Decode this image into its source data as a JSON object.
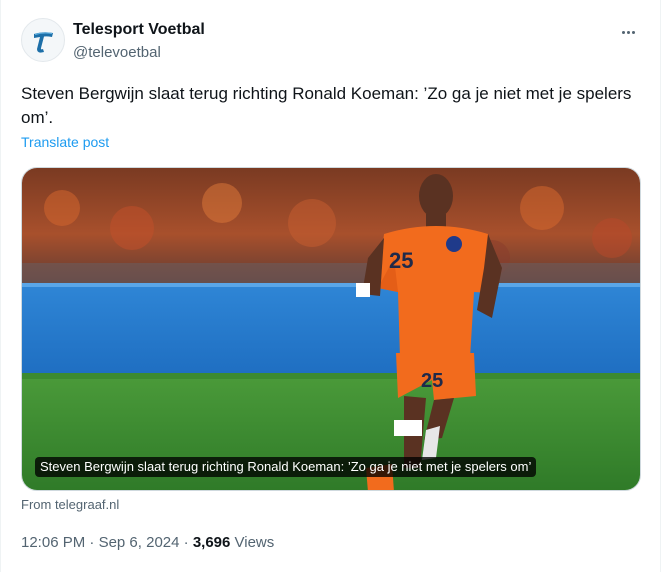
{
  "account": {
    "display_name": "Telesport Voetbal",
    "handle": "@televoetbal",
    "avatar_icon": "telesport-t-logo"
  },
  "post": {
    "text": "Steven Bergwijn slaat terug richting Ronald Koeman: ’Zo ga je niet met je spelers om’.",
    "translate_label": "Translate post"
  },
  "card": {
    "image_icon": "football-player-photo",
    "caption": "Steven Bergwijn slaat terug richting Ronald Koeman: ’Zo ga je niet met je spelers om’",
    "source": "From telegraaf.nl",
    "jersey_number": "25"
  },
  "meta": {
    "time": "12:06 PM",
    "separator": " · ",
    "date": "Sep 6, 2024",
    "views_count": "3,696",
    "views_label": " Views"
  },
  "colors": {
    "link": "#1d9bf0",
    "secondary_text": "#536471",
    "primary_text": "#0f1419",
    "jersey_orange": "#f26b1d"
  }
}
